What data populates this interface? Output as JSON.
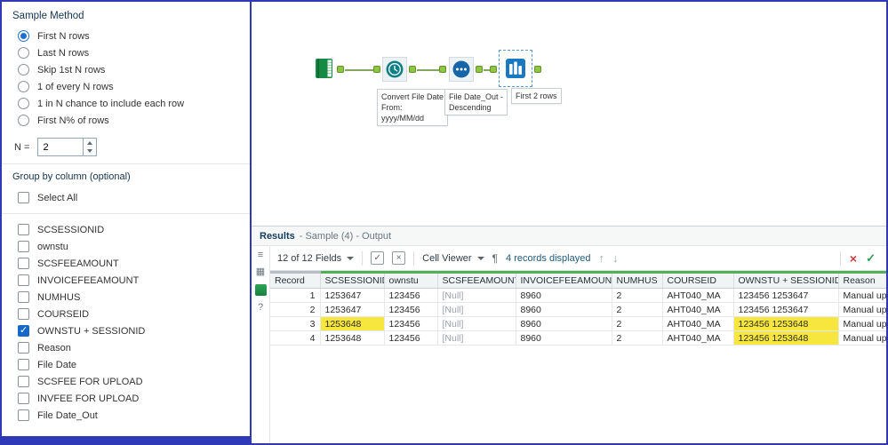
{
  "colors": {
    "accent": "#2e39b8",
    "highlight": "#f7e63e",
    "selected_blue": "#1669c9",
    "quality_green": "#55b055"
  },
  "config": {
    "title": "Sample Method",
    "options": [
      {
        "label": "First N rows",
        "selected": true
      },
      {
        "label": "Last N rows",
        "selected": false
      },
      {
        "label": "Skip 1st N rows",
        "selected": false
      },
      {
        "label": "1 of every N rows",
        "selected": false
      },
      {
        "label": "1 in N chance to include each row",
        "selected": false
      },
      {
        "label": "First N% of rows",
        "selected": false
      }
    ],
    "n_label": "N =",
    "n_value": "2",
    "group_label": "Group by column (optional)",
    "select_all": "Select All",
    "columns": [
      {
        "label": "SCSESSIONID",
        "checked": false
      },
      {
        "label": "ownstu",
        "checked": false
      },
      {
        "label": "SCSFEEAMOUNT",
        "checked": false
      },
      {
        "label": "INVOICEFEEAMOUNT",
        "checked": false
      },
      {
        "label": "NUMHUS",
        "checked": false
      },
      {
        "label": "COURSEID",
        "checked": false
      },
      {
        "label": "OWNSTU + SESSIONID",
        "checked": true
      },
      {
        "label": "Reason",
        "checked": false
      },
      {
        "label": "File Date",
        "checked": false
      },
      {
        "label": "SCSFEE FOR UPLOAD",
        "checked": false
      },
      {
        "label": "INVFEE FOR UPLOAD",
        "checked": false
      },
      {
        "label": "File Date_Out",
        "checked": false
      }
    ]
  },
  "canvas": {
    "tools": [
      {
        "name": "Input Data",
        "annotation": ""
      },
      {
        "name": "DateTime",
        "annotation": "Convert File Date\nFrom:\nyyyy/MM/dd"
      },
      {
        "name": "Sort",
        "annotation": "File Date_Out -\nDescending"
      },
      {
        "name": "Sample",
        "annotation": "First 2 rows",
        "selected": true
      }
    ]
  },
  "results": {
    "title": "Results",
    "subtitle": "- Sample (4) - Output",
    "toolbar": {
      "fields": "12 of 12 Fields",
      "cell_viewer": "Cell Viewer",
      "records": "4 records displayed",
      "icons": {
        "pilcrow": "¶",
        "up": "↑",
        "down": "↓",
        "close": "×",
        "check": "✓",
        "select_check": "✓",
        "deselect_x": "×"
      }
    },
    "strip": {
      "metadata": "≡",
      "grid": "▦",
      "help": "?"
    },
    "table": {
      "headers": [
        "Record",
        "SCSESSIONID",
        "ownstu",
        "SCSFEEAMOUNT",
        "INVOICEFEEAMOUNT",
        "NUMHUS",
        "COURSEID",
        "OWNSTU + SESSIONID",
        "Reason"
      ],
      "rows": [
        {
          "cells": [
            "1",
            "1253647",
            "123456",
            "[Null]",
            "8960",
            "2",
            "AHT040_MA",
            "123456 1253647",
            "Manual upload"
          ],
          "hl": []
        },
        {
          "cells": [
            "2",
            "1253647",
            "123456",
            "[Null]",
            "8960",
            "2",
            "AHT040_MA",
            "123456 1253647",
            "Manual upload"
          ],
          "hl": []
        },
        {
          "cells": [
            "3",
            "1253648",
            "123456",
            "[Null]",
            "8960",
            "2",
            "AHT040_MA",
            "123456 1253648",
            "Manual upload"
          ],
          "hl": [
            1,
            7
          ]
        },
        {
          "cells": [
            "4",
            "1253648",
            "123456",
            "[Null]",
            "8960",
            "2",
            "AHT040_MA",
            "123456 1253648",
            "Manual upload"
          ],
          "hl": [
            7
          ]
        }
      ]
    }
  }
}
